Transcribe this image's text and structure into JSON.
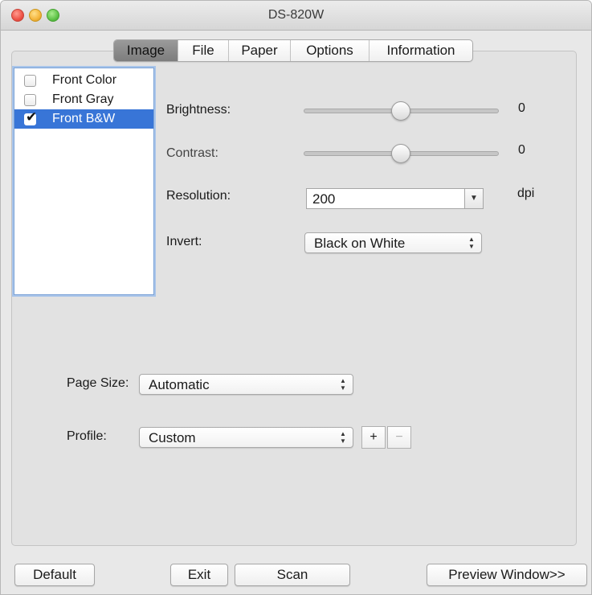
{
  "window": {
    "title": "DS-820W"
  },
  "tabs": [
    {
      "label": "Image",
      "active": true
    },
    {
      "label": "File",
      "active": false
    },
    {
      "label": "Paper",
      "active": false
    },
    {
      "label": "Options",
      "active": false
    },
    {
      "label": "Information",
      "active": false
    }
  ],
  "image_list": [
    {
      "label": "Front Color",
      "checked": false,
      "selected": false
    },
    {
      "label": "Front Gray",
      "checked": false,
      "selected": false
    },
    {
      "label": "Front B&W",
      "checked": true,
      "selected": true
    }
  ],
  "brightness": {
    "label": "Brightness:",
    "value": "0",
    "level": 0.5
  },
  "contrast": {
    "label": "Contrast:",
    "value": "0",
    "level": 0.5
  },
  "resolution": {
    "label": "Resolution:",
    "value": "200",
    "unit": "dpi"
  },
  "invert": {
    "label": "Invert:",
    "value": "Black on White"
  },
  "page_size": {
    "label": "Page Size:",
    "value": "Automatic"
  },
  "profile": {
    "label": "Profile:",
    "value": "Custom",
    "add_label": "+",
    "remove_label": "−"
  },
  "buttons": {
    "default": "Default",
    "exit": "Exit",
    "scan": "Scan",
    "preview": "Preview Window>>"
  },
  "colors": {
    "selection": "#3875d7",
    "window_bg": "#e8e8e8"
  }
}
